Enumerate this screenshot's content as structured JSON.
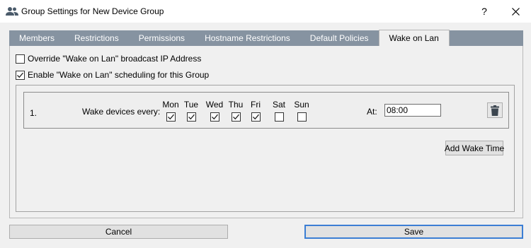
{
  "window": {
    "title": "Group Settings for New Device Group",
    "help_label": "?",
    "title_icon": "users-icon"
  },
  "tabs": [
    {
      "label": "Members",
      "active": false
    },
    {
      "label": "Restrictions",
      "active": false
    },
    {
      "label": "Permissions",
      "active": false
    },
    {
      "label": "Hostname Restrictions",
      "active": false
    },
    {
      "label": "Default Policies",
      "active": false
    },
    {
      "label": "Wake on Lan",
      "active": true
    }
  ],
  "options": {
    "override_label": "Override \"Wake on Lan\" broadcast IP Address",
    "override_checked": false,
    "enable_label": "Enable \"Wake on Lan\" scheduling for this Group",
    "enable_checked": true
  },
  "schedule": {
    "index": "1.",
    "wake_label": "Wake devices every:",
    "days": [
      {
        "label": "Mon",
        "checked": true
      },
      {
        "label": "Tue",
        "checked": true
      },
      {
        "label": "Wed",
        "checked": true
      },
      {
        "label": "Thu",
        "checked": true
      },
      {
        "label": "Fri",
        "checked": true
      },
      {
        "label": "Sat",
        "checked": false
      },
      {
        "label": "Sun",
        "checked": false
      }
    ],
    "at_label": "At:",
    "time_value": "08:00",
    "delete_icon": "trash-icon"
  },
  "buttons": {
    "add_wake_time": "Add Wake Time",
    "cancel": "Cancel",
    "save": "Save"
  },
  "colors": {
    "tab_bar": "#8693a1",
    "focus_border": "#3b7ed4"
  }
}
